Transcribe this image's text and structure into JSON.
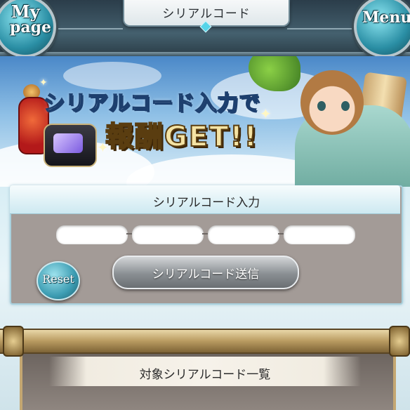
{
  "header": {
    "title": "シリアルコード",
    "mypage_line1": "My",
    "mypage_line2": "page",
    "menu_label": "Menu"
  },
  "banner": {
    "line1": "シリアルコード入力で",
    "line2": "報酬GET!!"
  },
  "serial_panel": {
    "title": "シリアルコード入力",
    "fields": [
      {
        "value": ""
      },
      {
        "value": ""
      },
      {
        "value": ""
      },
      {
        "value": ""
      }
    ],
    "submit_label": "シリアルコード送信",
    "reset_label": "Reset"
  },
  "list": {
    "title": "対象シリアルコード一覧"
  }
}
